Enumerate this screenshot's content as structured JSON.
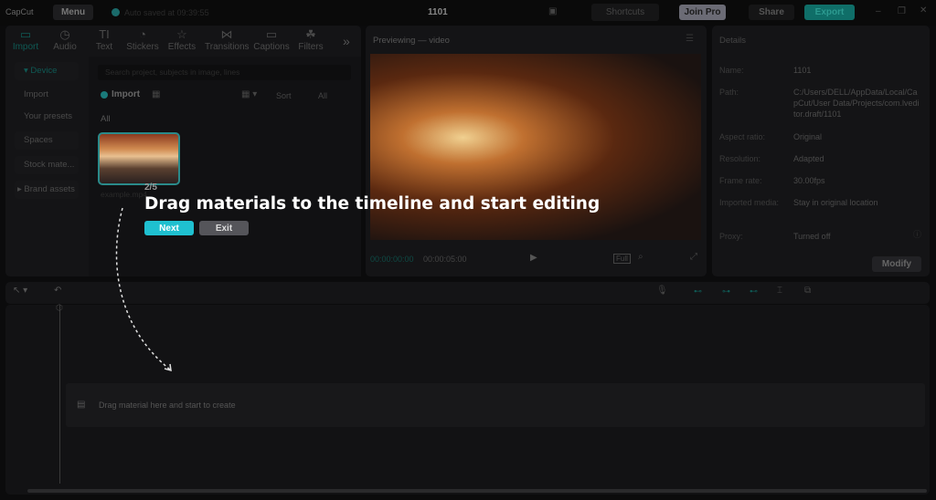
{
  "topbar": {
    "logo": "CapCut",
    "menu": "Menu",
    "autosave": "Auto saved at 09:39:55",
    "project_title": "1101",
    "shortcuts": "Shortcuts",
    "join_pro": "Join Pro",
    "share": "Share",
    "export": "Export"
  },
  "tabs": [
    {
      "label": "Import",
      "icon": "import-icon"
    },
    {
      "label": "Audio",
      "icon": "audio-icon"
    },
    {
      "label": "Text",
      "icon": "text-icon"
    },
    {
      "label": "Stickers",
      "icon": "stickers-icon"
    },
    {
      "label": "Effects",
      "icon": "effects-icon"
    },
    {
      "label": "Transitions",
      "icon": "transitions-icon"
    },
    {
      "label": "Captions",
      "icon": "captions-icon"
    },
    {
      "label": "Filters",
      "icon": "filters-icon"
    }
  ],
  "sidebar": [
    "Device",
    "Import",
    "Your presets",
    "Spaces",
    "Stock mate...",
    "Brand assets"
  ],
  "media": {
    "search_placeholder": "Search project, subjects in image, lines",
    "import": "Import",
    "sort": "Sort",
    "all_filter": "All",
    "all_label": "All",
    "file_name": "example.mp4"
  },
  "preview": {
    "title": "Previewing — video",
    "time_current": "00:00:00:00",
    "time_total": "00:00:05:00",
    "full": "Full"
  },
  "details": {
    "title": "Details",
    "rows": [
      {
        "label": "Name:",
        "value": "1101"
      },
      {
        "label": "Path:",
        "value": "C:/Users/DELL/AppData/Local/CapCut/User Data/Projects/com.lveditor.draft/1101"
      },
      {
        "label": "Aspect ratio:",
        "value": "Original"
      },
      {
        "label": "Resolution:",
        "value": "Adapted"
      },
      {
        "label": "Frame rate:",
        "value": "30.00fps"
      },
      {
        "label": "Imported media:",
        "value": "Stay in original location"
      },
      {
        "label": "Proxy:",
        "value": "Turned off"
      }
    ],
    "modify": "Modify"
  },
  "tour": {
    "step": "2/5",
    "message": "Drag materials to the timeline and start editing",
    "next": "Next",
    "exit": "Exit"
  },
  "timeline": {
    "drop_hint": "Drag material here and start to create"
  },
  "colors": {
    "accent": "#1fc0d0",
    "export": "#0f6e68"
  }
}
